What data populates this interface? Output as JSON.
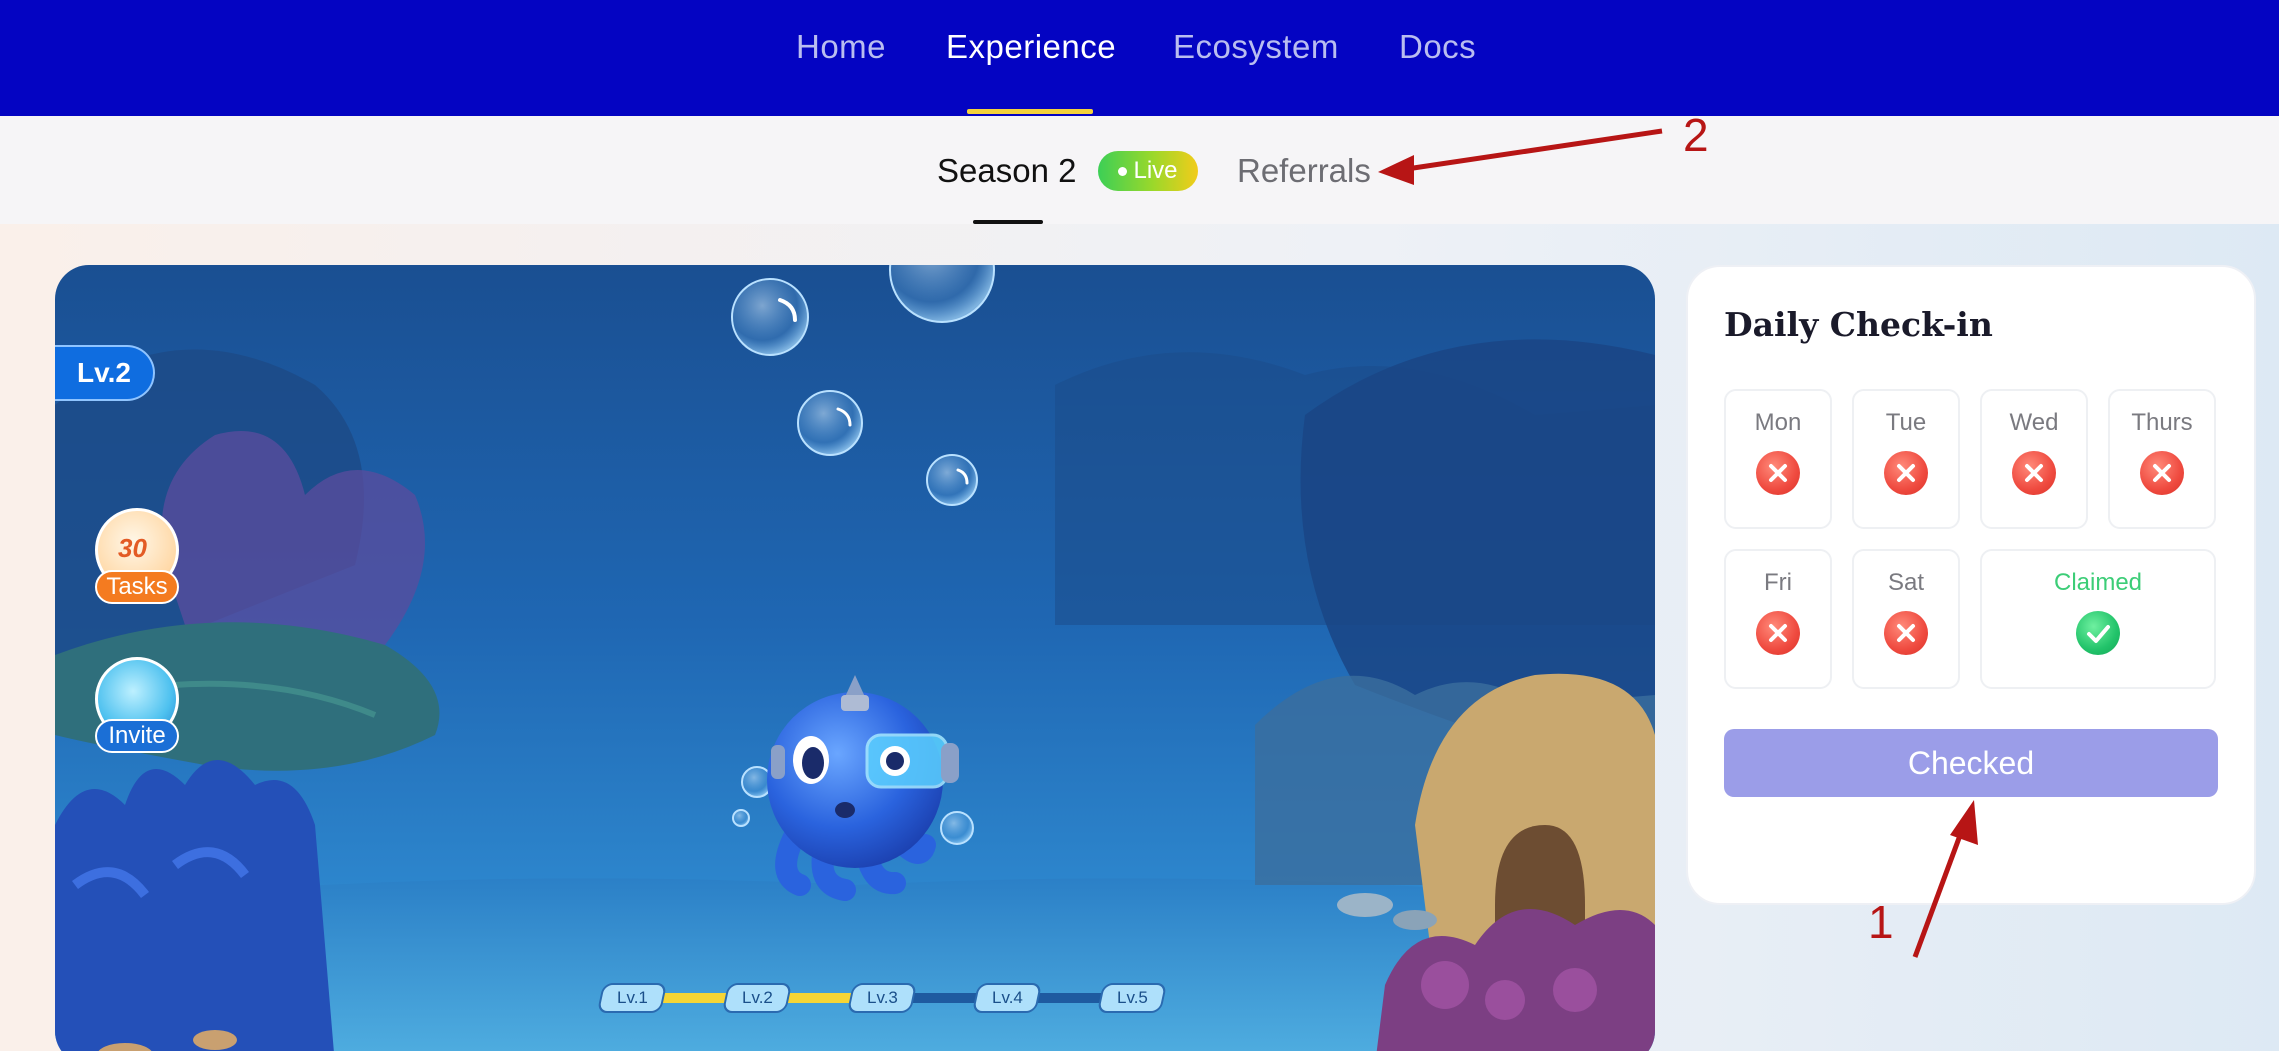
{
  "nav": {
    "items": [
      {
        "label": "Home",
        "active": false
      },
      {
        "label": "Experience",
        "active": true
      },
      {
        "label": "Ecosystem",
        "active": false
      },
      {
        "label": "Docs",
        "active": false
      }
    ],
    "accent_color": "#f4d23c",
    "background_color": "#0404c2"
  },
  "subnav": {
    "season_label": "Season 2",
    "live_badge": "Live",
    "referrals_label": "Referrals"
  },
  "game": {
    "level_badge": "Lv.2",
    "side_buttons": [
      {
        "label": "Tasks",
        "icon": "calendar-icon",
        "number": "30"
      },
      {
        "label": "Invite",
        "icon": "mascot-icon"
      }
    ],
    "progress_levels": [
      "Lv.1",
      "Lv.2",
      "Lv.3",
      "Lv.4",
      "Lv.5"
    ],
    "progress_fraction": 0.5
  },
  "checkin": {
    "title": "Daily Check-in",
    "days": [
      {
        "label": "Mon",
        "status": "missed"
      },
      {
        "label": "Tue",
        "status": "missed"
      },
      {
        "label": "Wed",
        "status": "missed"
      },
      {
        "label": "Thurs",
        "status": "missed"
      },
      {
        "label": "Fri",
        "status": "missed"
      },
      {
        "label": "Sat",
        "status": "missed"
      },
      {
        "label": "Claimed",
        "status": "claimed"
      }
    ],
    "button_label": "Checked",
    "missed_color": "#ef4a3f",
    "claimed_color": "#22c36a"
  },
  "annotations": {
    "arrow_1_label": "1",
    "arrow_2_label": "2",
    "color": "#b71515"
  }
}
